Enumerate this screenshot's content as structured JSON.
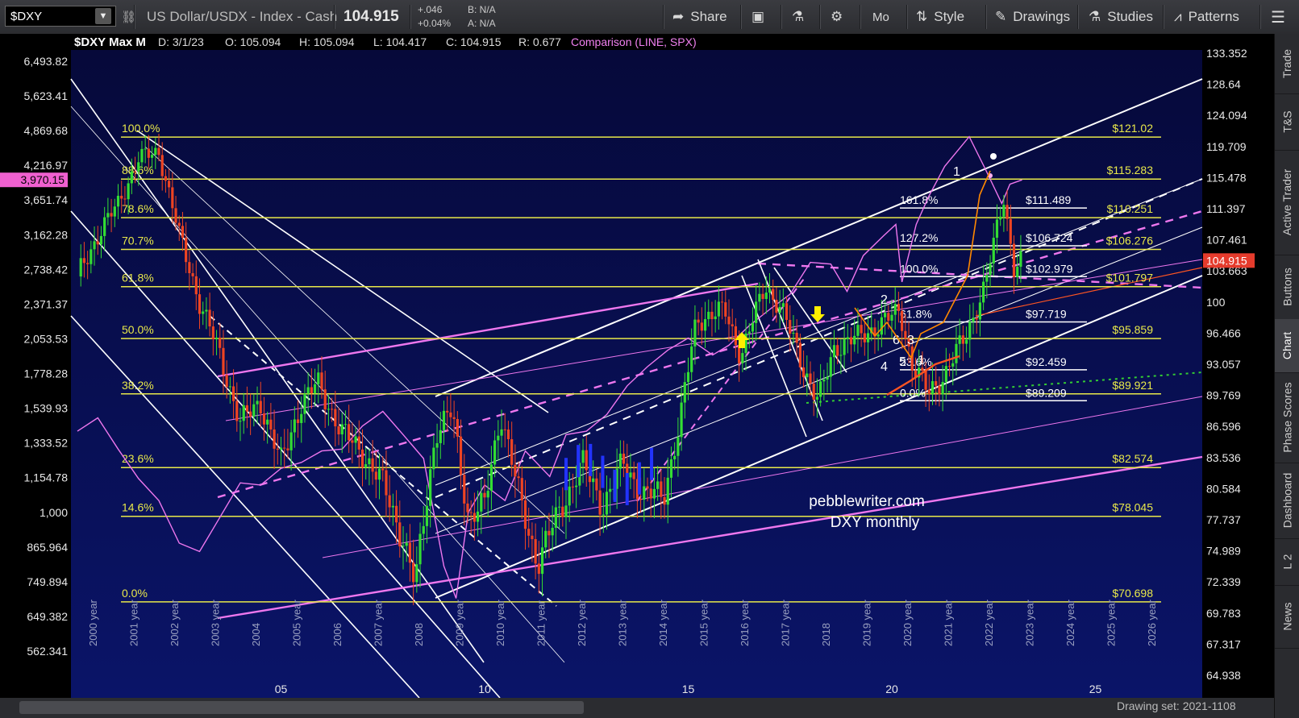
{
  "toolbar": {
    "symbol": "$DXY",
    "description": "US Dollar/USDX - Index - Cash",
    "last": "104.915",
    "change": "+.046",
    "change_pct": "+0.04%",
    "bid": "B: N/A",
    "ask": "A: N/A",
    "share": "Share",
    "period": "Mo",
    "style": "Style",
    "drawings": "Drawings",
    "studies": "Studies",
    "patterns": "Patterns"
  },
  "header": {
    "title": "$DXY Max M",
    "date": "D: 3/1/23",
    "open": "O: 105.094",
    "high": "H: 105.094",
    "low": "L: 104.417",
    "close": "C: 104.915",
    "range": "R: 0.677",
    "comparison": "Comparison (LINE, SPX)"
  },
  "watermark": {
    "line1": "pebblewriter.com",
    "line2": "DXY monthly"
  },
  "right_tabs": [
    "Trade",
    "T&S",
    "Active Trader",
    "Buttons",
    "Chart",
    "Phase Scores",
    "Dashboard",
    "L 2",
    "News"
  ],
  "bottom": {
    "drawing_set": "Drawing set: 2021-1108"
  },
  "colors": {
    "background": "#050a44",
    "fib": "#e8e84a",
    "magenta": "#ee77ee",
    "up": "#33dd33",
    "down": "#ee4422",
    "price_badge": "#e53b2c",
    "spx_badge": "#f060d0"
  },
  "chart_data": {
    "type": "candlestick",
    "title": "$DXY Max M",
    "price_axis_right": [
      "133.352",
      "128.64",
      "124.094",
      "119.709",
      "115.478",
      "111.397",
      "107.461",
      "103.663",
      "100",
      "96.466",
      "93.057",
      "89.769",
      "86.596",
      "83.536",
      "80.584",
      "77.737",
      "74.989",
      "72.339",
      "69.783",
      "67.317",
      "64.938"
    ],
    "spx_axis_left": [
      "6,493.82",
      "5,623.41",
      "4,869.68",
      "4,216.97",
      "3,651.74",
      "3,162.28",
      "2,738.42",
      "2,371.37",
      "2,053.53",
      "1,778.28",
      "1,539.93",
      "1,333.52",
      "1,154.78",
      "1,000",
      "865.964",
      "749.894",
      "649.382",
      "562.341"
    ],
    "x_year_labels": [
      "2000 year",
      "2001 year",
      "2002 year",
      "2003 year",
      "2004",
      "2005 year",
      "2006",
      "2007 year",
      "2008",
      "2009 year",
      "2010 year",
      "2011 year",
      "2012 year",
      "2013 year",
      "2014 year",
      "2015 year",
      "2016 year",
      "2017 year",
      "2018",
      "2019 year",
      "2020 year",
      "2021 year",
      "2022 year",
      "2023 year",
      "2024 year",
      "2025 year",
      "2026 year"
    ],
    "x_axis_labels": [
      "05",
      "10",
      "15",
      "20",
      "25"
    ],
    "last_price": "104.915",
    "spx_last": "3,970.15",
    "fib_levels_left": [
      {
        "label": "100.0%",
        "price": "$121.02",
        "value": 121.02
      },
      {
        "label": "88.6%",
        "price": "$115.283",
        "value": 115.283
      },
      {
        "label": "78.6%",
        "price": "$110.251",
        "value": 110.251
      },
      {
        "label": "70.7%",
        "price": "$106.276",
        "value": 106.276
      },
      {
        "label": "61.8%",
        "price": "$101.797",
        "value": 101.797
      },
      {
        "label": "50.0%",
        "price": "$95.859",
        "value": 95.859
      },
      {
        "label": "38.2%",
        "price": "$89.921",
        "value": 89.921
      },
      {
        "label": "23.6%",
        "price": "$82.574",
        "value": 82.574
      },
      {
        "label": "14.6%",
        "price": "$78.045",
        "value": 78.045
      },
      {
        "label": "0.0%",
        "price": "$70.698",
        "value": 70.698
      }
    ],
    "fib_levels_right": [
      {
        "label": "161.8%",
        "price": "$111.489",
        "value": 111.489
      },
      {
        "label": "127.2%",
        "price": "$106.724",
        "value": 106.724
      },
      {
        "label": "100.0%",
        "price": "$102.979",
        "value": 102.979
      },
      {
        "label": "61.8%",
        "price": "$97.719",
        "value": 97.719
      },
      {
        "label": "23.6%",
        "price": "$92.459",
        "value": 92.459
      },
      {
        "label": "0.0%",
        "price": "$89.209",
        "value": 89.209
      }
    ],
    "wave_labels": [
      "1",
      "2",
      "4",
      "6",
      "3",
      "5",
      "1"
    ]
  }
}
